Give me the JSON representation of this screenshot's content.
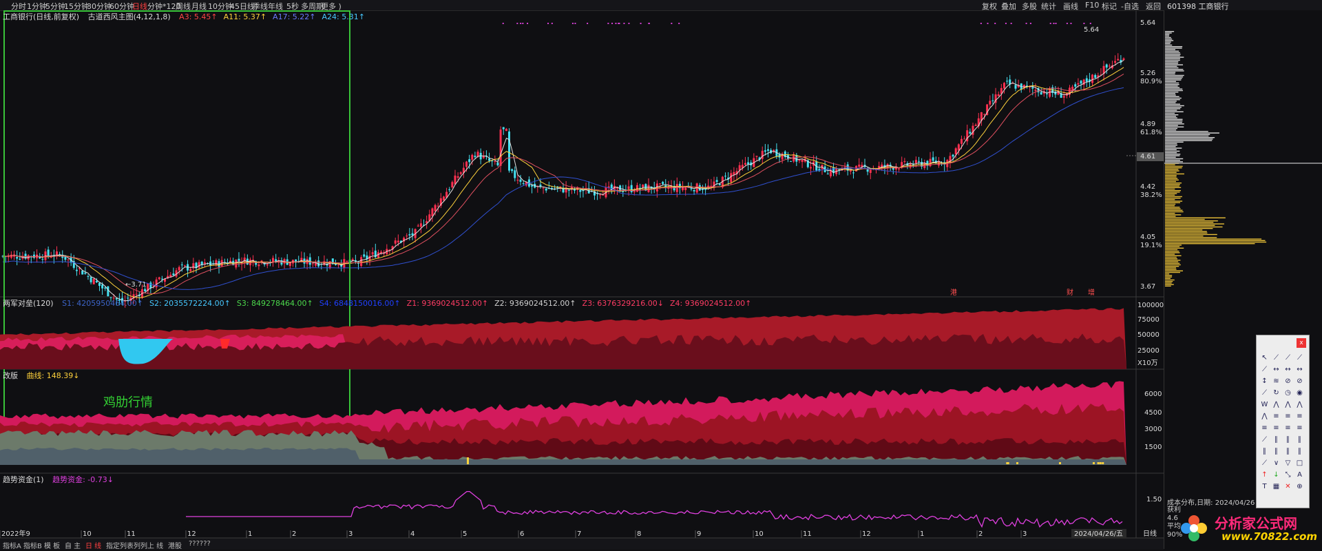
{
  "top_menu": {
    "left": [
      "分时",
      "1分钟",
      "5分钟",
      "15分钟",
      "30分钟",
      "60分钟",
      "日线",
      "分钟*120",
      "周线",
      "月线",
      "10分钟",
      "45日线",
      "季线",
      "年线",
      "5秒",
      "多周期",
      "更多 )"
    ],
    "right": [
      "复权",
      "叠加",
      "多股",
      "统计",
      "画线",
      "F10",
      "标记",
      "-自选",
      "返回"
    ],
    "active": "日线"
  },
  "stock": {
    "code": "601398",
    "name": "工商银行"
  },
  "main_panel": {
    "title": "工商银行(日线,前复权)",
    "indicator": "古道西风主图(4,12,1,8)",
    "values": [
      {
        "label": "A3: 5.45↑",
        "color": "#ff4444"
      },
      {
        "label": "A11: 5.37↑",
        "color": "#ffd23c"
      },
      {
        "label": "A17: 5.22↑",
        "color": "#6b7bff"
      },
      {
        "label": "A24: 5.31↑",
        "color": "#47c8ff"
      }
    ],
    "y_ticks": [
      "5.64",
      "5.26",
      "80.9%",
      "4.89",
      "61.8%",
      "4.61",
      "4.42",
      "38.2%",
      "4.05",
      "19.1%",
      "3.67"
    ],
    "annotations": {
      "high": "5.64",
      "low": "3.71",
      "markers": [
        "港",
        "财",
        "增"
      ]
    },
    "overlay_text": "鸡肋行情"
  },
  "panel2": {
    "title": "两军对垒(120)",
    "values": [
      {
        "label": "S1: 4205950464.00↑",
        "color": "#3c64c8"
      },
      {
        "label": "S2: 2035572224.00↑",
        "color": "#47c8ff"
      },
      {
        "label": "S3: 849278464.00↑",
        "color": "#4cd94c"
      },
      {
        "label": "S4: 6848150016.00↑",
        "color": "#2040ff"
      },
      {
        "label": "Z1: 9369024512.00↑",
        "color": "#ff3c64"
      },
      {
        "label": "Z2: 9369024512.00↑",
        "color": "#d0d0d0"
      },
      {
        "label": "Z3: 6376329216.00↓",
        "color": "#ff3c64"
      },
      {
        "label": "Z4: 9369024512.00↑",
        "color": "#ff3c64"
      }
    ],
    "y_ticks": [
      "100000",
      "75000",
      "50000",
      "25000"
    ],
    "unit": "X10万"
  },
  "panel3": {
    "title": "改版",
    "values": [
      {
        "label": "曲线: 148.39↓",
        "color": "#ffd23c"
      }
    ],
    "y_ticks": [
      "6000",
      "4500",
      "3000",
      "1500"
    ]
  },
  "panel4": {
    "title": "趋势资金(1)",
    "values": [
      {
        "label": "趋势资金: -0.73↓",
        "color": "#e040e0"
      }
    ],
    "y_ticks": [
      "1.50"
    ]
  },
  "x_axis": {
    "labels": [
      "2022年9",
      "10",
      "11",
      "12",
      "1",
      "2",
      "3",
      "4",
      "5",
      "6",
      "7",
      "8",
      "9",
      "10",
      "11",
      "12",
      "1",
      "2",
      "3"
    ],
    "end_date": "2024/04/26/五",
    "right_label": "日线"
  },
  "cost_distribution": {
    "title": "成本分布,日期: 2024/04/26",
    "lines": [
      "获利",
      "4.6",
      "平均",
      "90%"
    ]
  },
  "toolbox": {
    "close": "x"
  },
  "bottom_tabs": [
    "指标A",
    "指标B",
    "模 板",
    "自 主",
    "日 线",
    "指定列",
    "表列列",
    "上 线",
    "港股",
    "??????"
  ],
  "watermark": {
    "text": "分析家公式网",
    "url": "www.70822.com"
  },
  "chart_data": {
    "type": "candlestick",
    "title": "工商银行(日线,前复权)",
    "x_labels": [
      "2022年9",
      "10",
      "11",
      "12",
      "1",
      "2",
      "3",
      "4",
      "5",
      "6",
      "7",
      "8",
      "9",
      "10",
      "11",
      "12",
      "1",
      "2",
      "3"
    ],
    "ylim": [
      3.67,
      5.64
    ],
    "close_trend": [
      {
        "x": "2022年9",
        "y": 4.05
      },
      {
        "x": "10",
        "y": 4.06
      },
      {
        "x": "11",
        "y": 3.71
      },
      {
        "x": "12",
        "y": 3.96
      },
      {
        "x": "1",
        "y": 4.02
      },
      {
        "x": "2",
        "y": 4.01
      },
      {
        "x": "3",
        "y": 4.0
      },
      {
        "x": "4",
        "y": 4.22
      },
      {
        "x": "5",
        "y": 4.8
      },
      {
        "x": "6",
        "y": 4.55
      },
      {
        "x": "7",
        "y": 4.52
      },
      {
        "x": "8",
        "y": 4.55
      },
      {
        "x": "9",
        "y": 4.55
      },
      {
        "x": "10",
        "y": 4.82
      },
      {
        "x": "11",
        "y": 4.67
      },
      {
        "x": "12",
        "y": 4.7
      },
      {
        "x": "1",
        "y": 4.74
      },
      {
        "x": "2",
        "y": 5.3
      },
      {
        "x": "3",
        "y": 5.22
      },
      {
        "x": "2024/04/26",
        "y": 5.5
      }
    ]
  }
}
